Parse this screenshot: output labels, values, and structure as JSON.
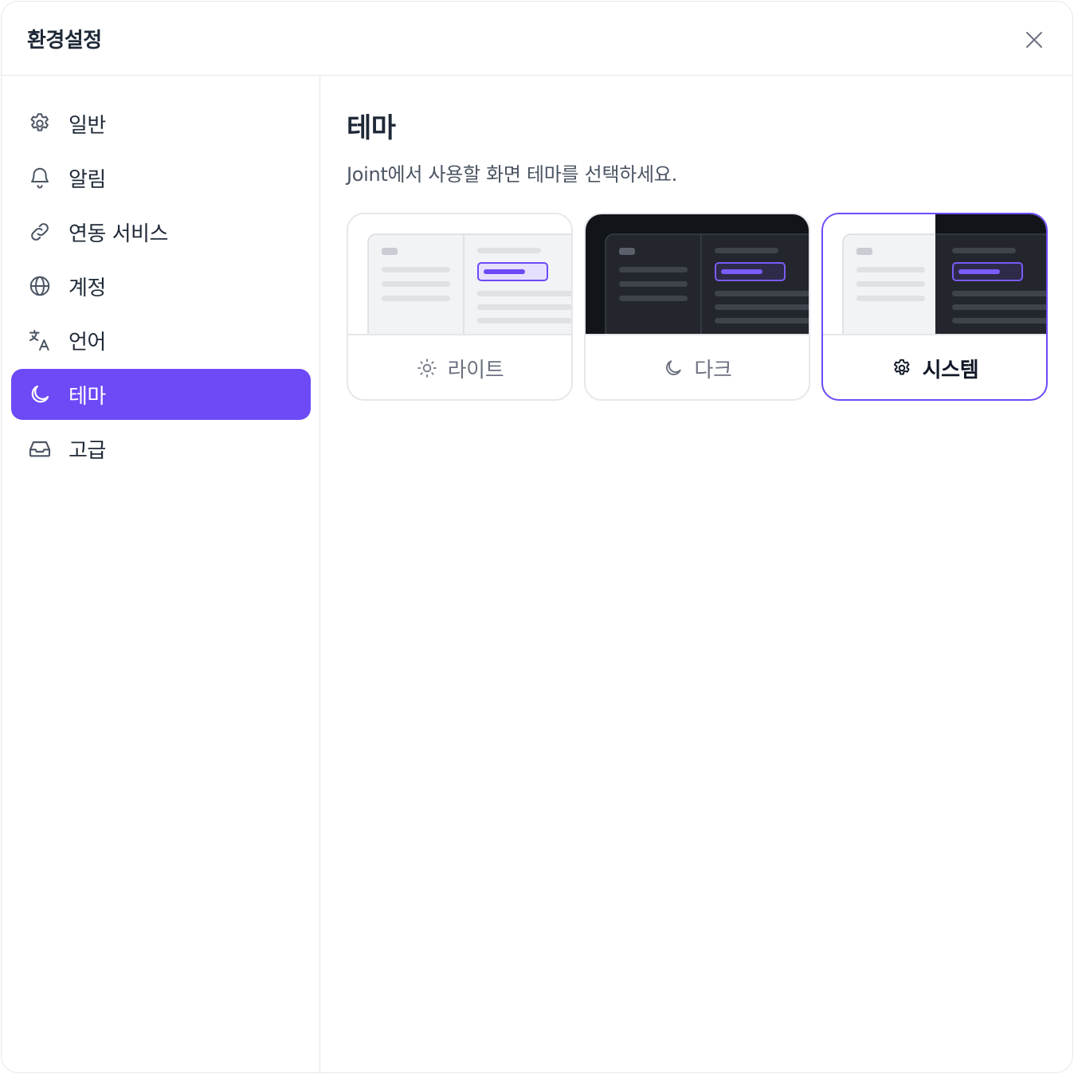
{
  "dialog": {
    "title": "환경설정",
    "close_icon": "close-icon"
  },
  "sidebar": {
    "items": [
      {
        "label": "일반",
        "icon": "gear-icon",
        "active": false
      },
      {
        "label": "알림",
        "icon": "bell-icon",
        "active": false
      },
      {
        "label": "연동 서비스",
        "icon": "link-icon",
        "active": false
      },
      {
        "label": "계정",
        "icon": "globe-icon",
        "active": false
      },
      {
        "label": "언어",
        "icon": "translate-icon",
        "active": false
      },
      {
        "label": "테마",
        "icon": "moon-icon",
        "active": true
      },
      {
        "label": "고급",
        "icon": "inbox-icon",
        "active": false
      }
    ]
  },
  "main": {
    "title": "테마",
    "description": "Joint에서 사용할 화면 테마를 선택하세요.",
    "themes": [
      {
        "label": "라이트",
        "icon": "sun-icon",
        "selected": false
      },
      {
        "label": "다크",
        "icon": "moon-icon",
        "selected": false
      },
      {
        "label": "시스템",
        "icon": "gear-icon",
        "selected": true
      }
    ]
  },
  "colors": {
    "accent": "#6d4af6",
    "text": "#1f2937",
    "muted": "#6b7280",
    "border": "#e5e7eb",
    "dark_bg": "#111418",
    "dark_panel": "#23262d"
  }
}
